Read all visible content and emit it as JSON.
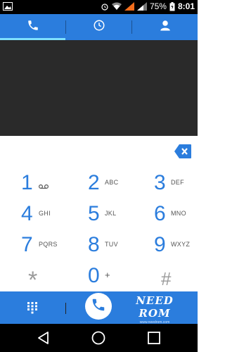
{
  "status_bar": {
    "battery": "75%",
    "time": "8:01"
  },
  "tabs": [
    {
      "name": "phone-tab",
      "icon": "phone-icon",
      "selected": true
    },
    {
      "name": "recents-tab",
      "icon": "clock-icon",
      "selected": false
    },
    {
      "name": "contacts-tab",
      "icon": "contact-icon",
      "selected": false
    }
  ],
  "keys": [
    {
      "digit": "1",
      "letters": "",
      "voicemail": true
    },
    {
      "digit": "2",
      "letters": "ABC"
    },
    {
      "digit": "3",
      "letters": "DEF"
    },
    {
      "digit": "4",
      "letters": "GHI"
    },
    {
      "digit": "5",
      "letters": "JKL"
    },
    {
      "digit": "6",
      "letters": "MNO"
    },
    {
      "digit": "7",
      "letters": "PQRS"
    },
    {
      "digit": "8",
      "letters": "TUV"
    },
    {
      "digit": "9",
      "letters": "WXYZ"
    },
    {
      "digit": "*",
      "letters": ""
    },
    {
      "digit": "0",
      "letters": "+"
    },
    {
      "digit": "#",
      "letters": ""
    }
  ],
  "watermark": {
    "logo": "NEED ROM",
    "url": "www.needrom.com"
  },
  "colors": {
    "accent": "#2b7ddd",
    "tab_indicator": "#7fe0ff",
    "display_bg": "#2a2a2a"
  }
}
